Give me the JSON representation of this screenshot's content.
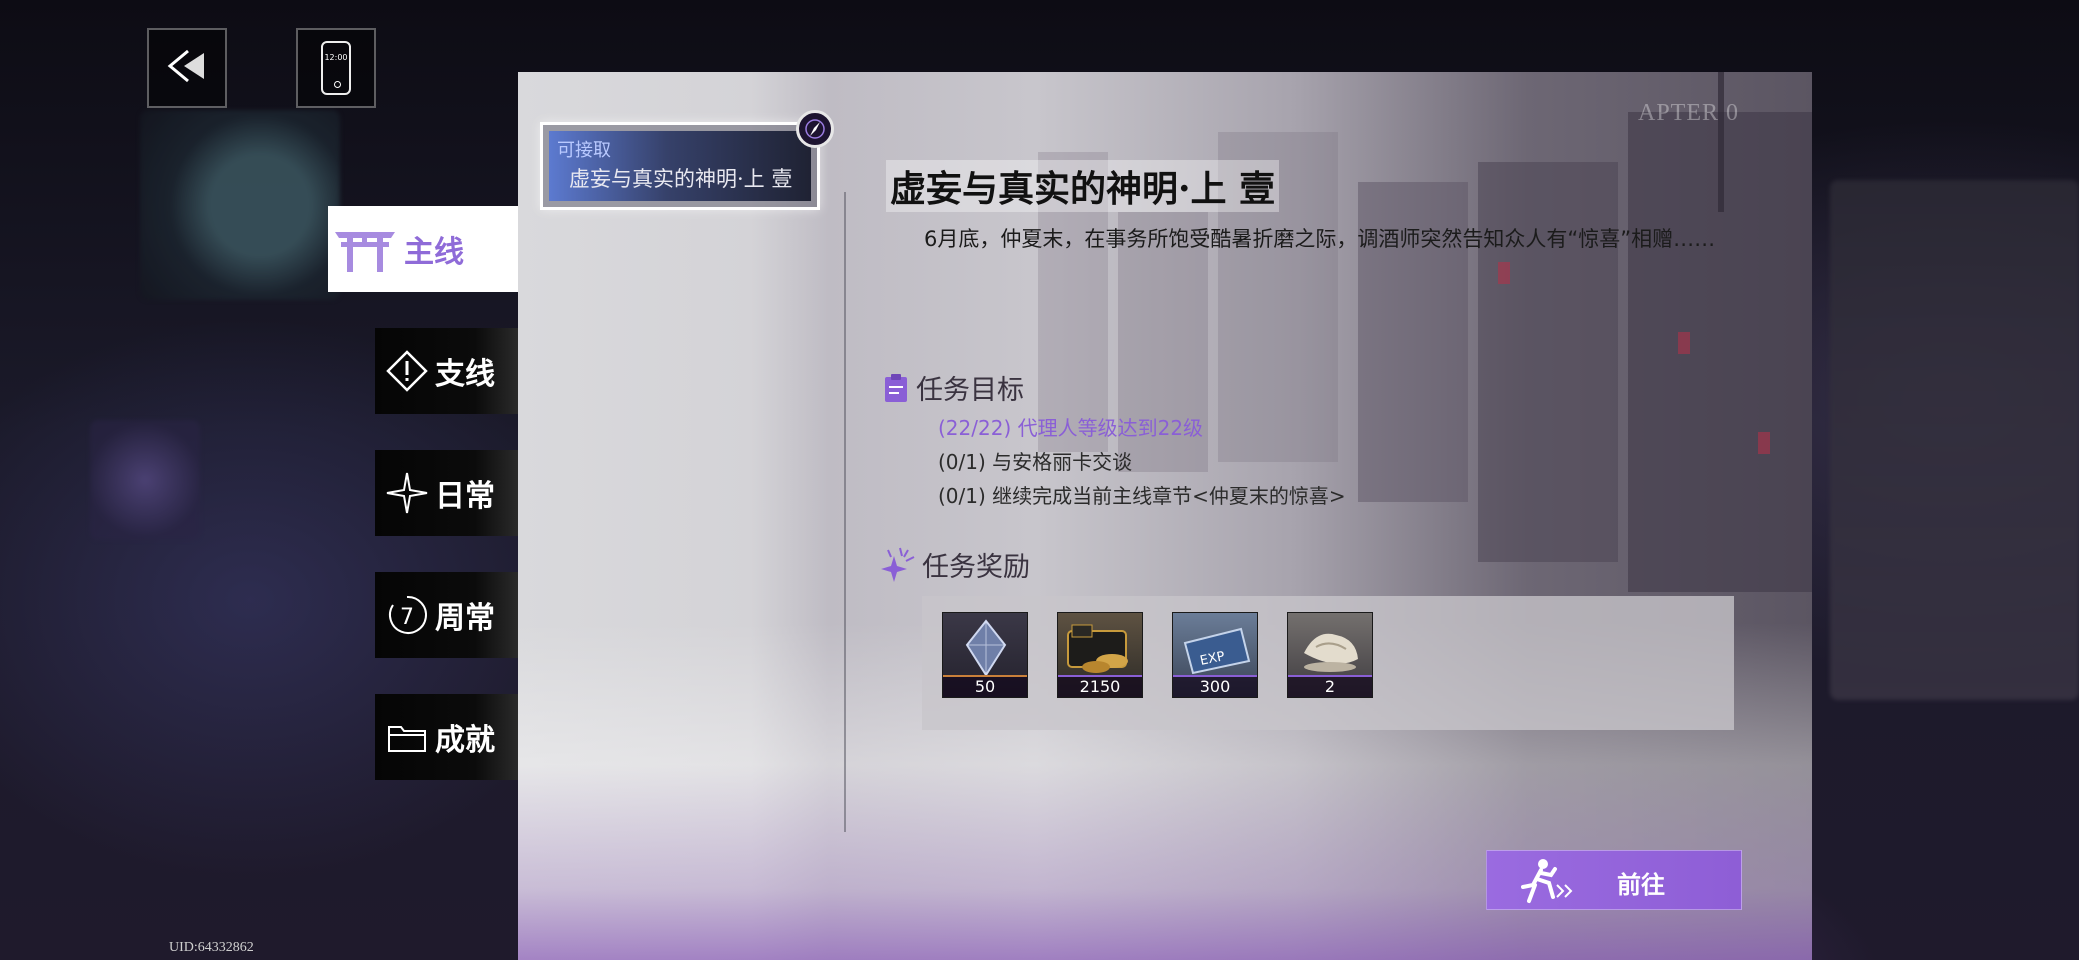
{
  "top_bar": {
    "back_icon": "back-arrow-icon",
    "phone_icon": "phone-icon",
    "phone_time": "12:00"
  },
  "uid": "UID:64332862",
  "categories": [
    {
      "label": "主线",
      "icon": "torii-gate-icon",
      "active": true
    },
    {
      "label": "支线",
      "icon": "warning-diamond-icon",
      "active": false
    },
    {
      "label": "日常",
      "icon": "compass-star-icon",
      "active": false
    },
    {
      "label": "周常",
      "icon": "cycle-seven-icon",
      "active": false
    },
    {
      "label": "成就",
      "icon": "folder-icon",
      "active": false
    }
  ],
  "quest_list": [
    {
      "status": "可接取",
      "name": "虚妄与真实的神明·上 壹"
    }
  ],
  "chapter_watermark": "APTER 0",
  "detail": {
    "title": "虚妄与真实的神明·上 壹",
    "description": "6月底，仲夏末，在事务所饱受酷暑折磨之际，调酒师突然告知众人有“惊喜”相赠……",
    "objectives_title": "任务目标",
    "objectives": [
      {
        "text": "(22/22) 代理人等级达到22级",
        "done": true
      },
      {
        "text": "(0/1) 与安格丽卡交谈",
        "done": false
      },
      {
        "text": "(0/1) 继续完成当前主线章节<仲夏末的惊喜>",
        "done": false
      }
    ],
    "rewards_title": "任务奖励",
    "rewards": [
      {
        "icon": "crystal-currency-icon",
        "count": "50",
        "rarity_color": "#c9803a"
      },
      {
        "icon": "gold-coins-card-icon",
        "count": "2150",
        "rarity_color": "#8a5fd6"
      },
      {
        "icon": "exp-ticket-icon",
        "count": "300",
        "rarity_color": "#8a5fd6"
      },
      {
        "icon": "material-bundle-icon",
        "count": "2",
        "rarity_color": "#8a5fd6"
      }
    ],
    "go_button": "前往",
    "go_icon": "running-person-icon"
  },
  "colors": {
    "accent": "#8e5ed6",
    "completed_objective": "#8a5fd6"
  }
}
